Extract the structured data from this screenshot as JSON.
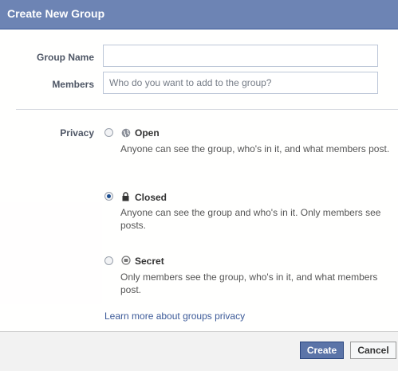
{
  "dialog": {
    "title": "Create New Group"
  },
  "form": {
    "group_name": {
      "label": "Group Name",
      "value": "",
      "placeholder": ""
    },
    "members": {
      "label": "Members",
      "value": "",
      "placeholder": "Who do you want to add to the group?"
    }
  },
  "privacy": {
    "label": "Privacy",
    "selected": "closed",
    "options": [
      {
        "id": "open",
        "title": "Open",
        "icon": "globe-icon",
        "description": "Anyone can see the group, who's in it, and what members post."
      },
      {
        "id": "closed",
        "title": "Closed",
        "icon": "lock-icon",
        "description": "Anyone can see the group and who's in it. Only members see posts."
      },
      {
        "id": "secret",
        "title": "Secret",
        "icon": "shield-icon",
        "description": "Only members see the group, who's in it, and what members post."
      }
    ],
    "learn_more": "Learn more about groups privacy"
  },
  "footer": {
    "create_label": "Create",
    "cancel_label": "Cancel"
  },
  "colors": {
    "title_bar": "#6d84b4",
    "link": "#3b5998",
    "primary_button": "#5b74a8"
  }
}
